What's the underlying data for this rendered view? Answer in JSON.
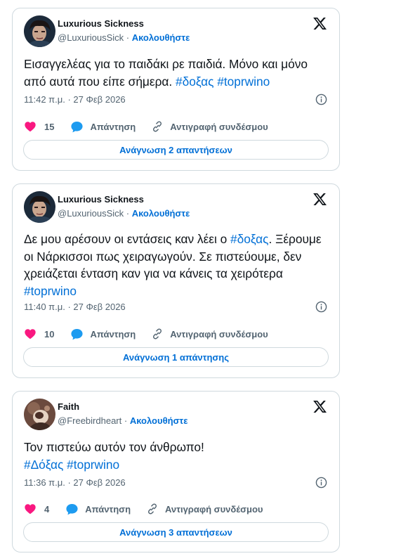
{
  "tweets": [
    {
      "name": "Luxurious Sickness",
      "handle": "@LuxuriousSick",
      "separator": "·",
      "follow_label": "Ακολουθήστε",
      "avatar_icon": "avatar-dark-portrait",
      "text_parts": [
        "Εισαγγελέας για το παιδάκι ρε παιδιά. Μόνο και μόνο από αυτά που είπε σήμερα. "
      ],
      "hashtags": [
        "#δοξας",
        "#toprwino"
      ],
      "timestamp": "11:42 π.μ. · 27 Φεβ 2026",
      "likes": "15",
      "reply_label": "Απάντηση",
      "copy_label": "Αντιγραφή συνδέσμου",
      "read_replies_label": "Ανάγνωση 2 απαντήσεων"
    },
    {
      "name": "Luxurious Sickness",
      "handle": "@LuxuriousSick",
      "separator": "·",
      "follow_label": "Ακολουθήστε",
      "avatar_icon": "avatar-dark-portrait",
      "text_parts": [
        "Δε μου αρέσουν οι εντάσεις καν λέει ο ",
        ". Ξέρουμε οι Νάρκισσοι πως χειραγωγούν. Σε πιστεύουμε, δεν χρειάζεται ένταση καν για να κάνεις τα χειρότερα  "
      ],
      "hashtags": [
        "#δοξας",
        "#toprwino"
      ],
      "timestamp": "11:40 π.μ. · 27 Φεβ 2026",
      "likes": "10",
      "reply_label": "Απάντηση",
      "copy_label": "Αντιγραφή συνδέσμου",
      "read_replies_label": "Ανάγνωση 1 απάντησης"
    },
    {
      "name": "Faith",
      "handle": "@Freebirdheart",
      "separator": "·",
      "follow_label": "Ακολουθήστε",
      "avatar_icon": "avatar-brown-portrait",
      "text_parts": [
        "Τον πιστεύω αυτόν τον άνθρωπο!"
      ],
      "hashtags": [
        "#Δόξας",
        "#toprwino"
      ],
      "timestamp": "11:36 π.μ. · 27 Φεβ 2026",
      "likes": "4",
      "reply_label": "Απάντηση",
      "copy_label": "Αντιγραφή συνδέσμου",
      "read_replies_label": "Ανάγνωση 3 απαντήσεων"
    }
  ],
  "colors": {
    "accent": "#006fd6",
    "heart": "#f91880",
    "reply_bubble": "#1d9bf0",
    "muted": "#536471",
    "border": "#cfd9de"
  },
  "icons": {
    "logo": "x-logo-icon",
    "like": "heart-icon",
    "reply": "reply-bubble-icon",
    "copy": "link-icon",
    "info": "info-icon"
  }
}
